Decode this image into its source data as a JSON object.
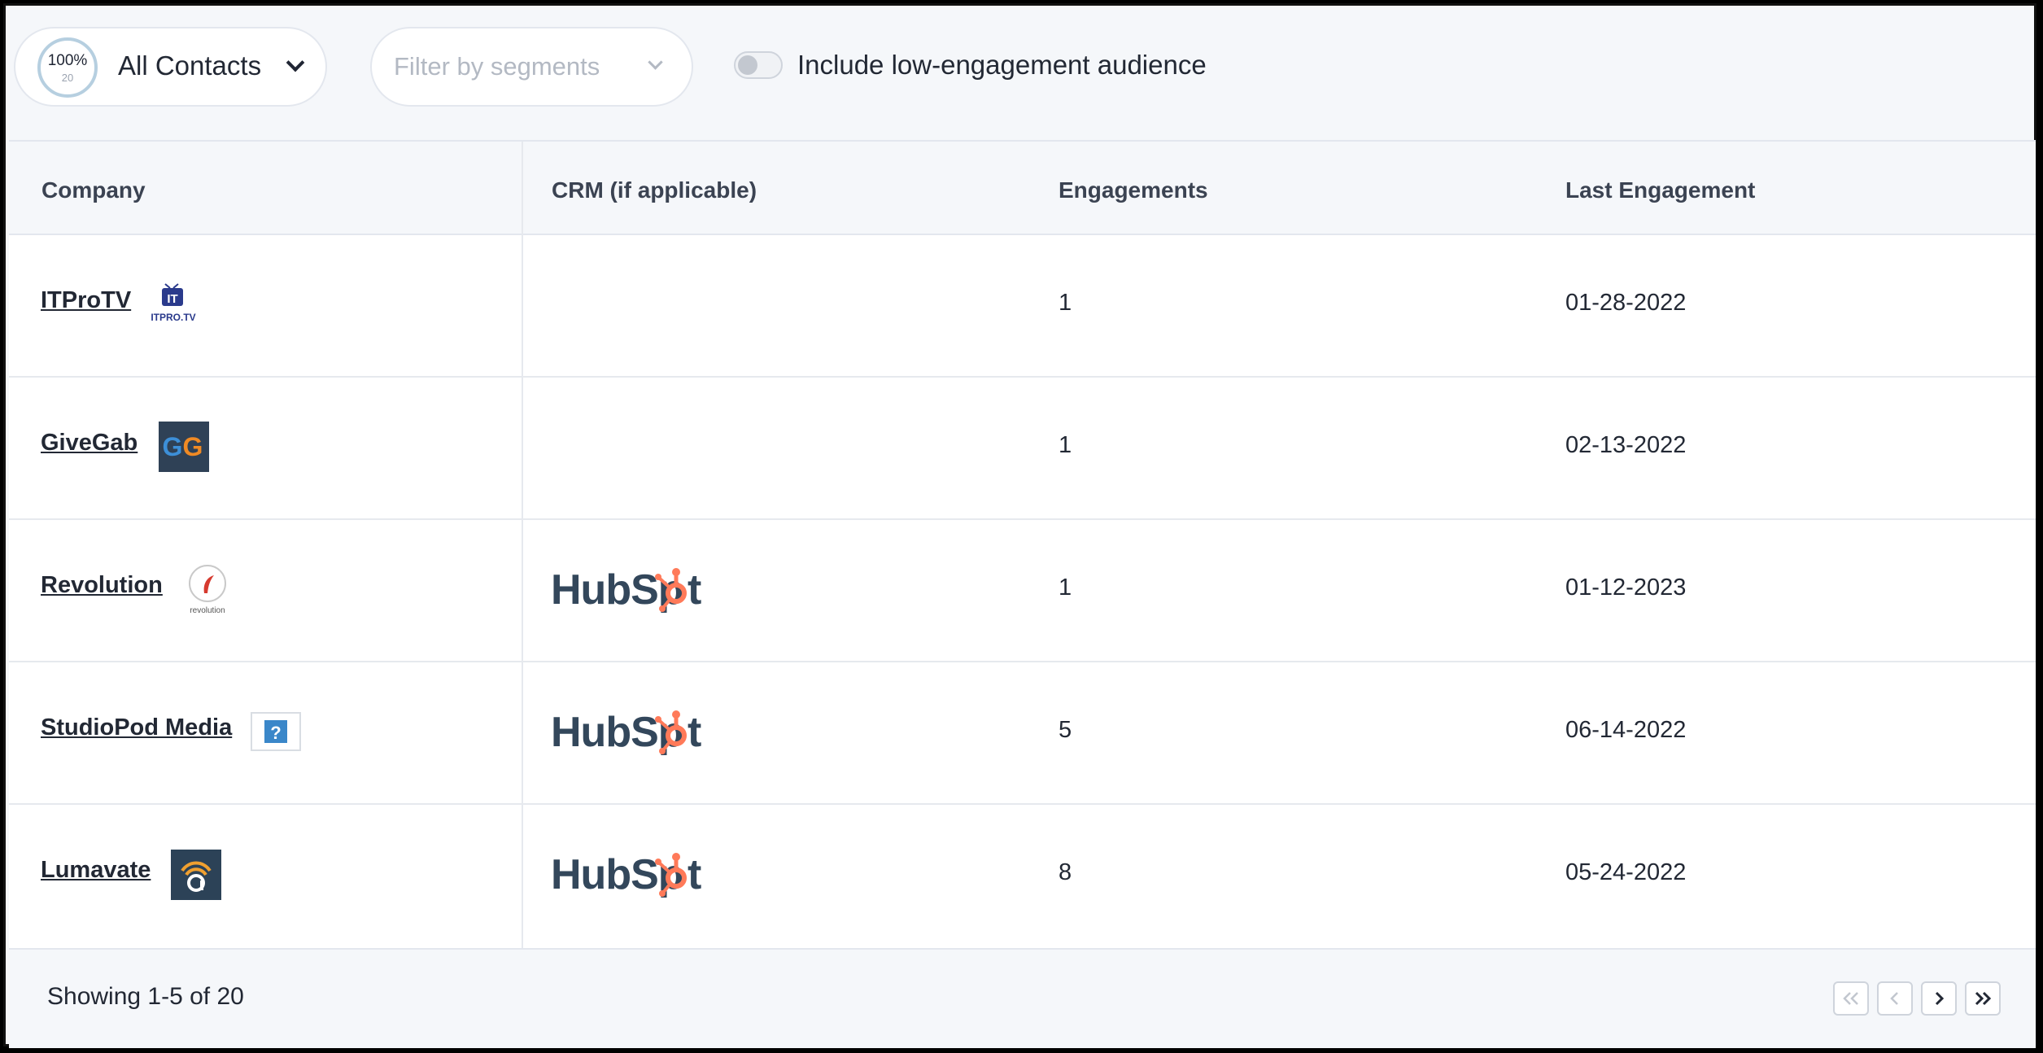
{
  "toolbar": {
    "contacts_percent": "100%",
    "contacts_count": "20",
    "contacts_label": "All Contacts",
    "segments_placeholder": "Filter by segments",
    "toggle_label": "Include low-engagement audience"
  },
  "table": {
    "columns": [
      "Company",
      "CRM (if applicable)",
      "Engagements",
      "Last Engagement"
    ],
    "rows": [
      {
        "company": "ITProTV",
        "logo": "itprotv-logo",
        "crm": "",
        "engagements": "1",
        "last": "01-28-2022"
      },
      {
        "company": "GiveGab",
        "logo": "givegab-logo",
        "crm": "",
        "engagements": "1",
        "last": "02-13-2022"
      },
      {
        "company": "Revolution",
        "logo": "revolution-logo",
        "crm": "HubSpot",
        "engagements": "1",
        "last": "01-12-2023"
      },
      {
        "company": "StudioPod Media",
        "logo": "broken-image-icon",
        "crm": "HubSpot",
        "engagements": "5",
        "last": "06-14-2022"
      },
      {
        "company": "Lumavate",
        "logo": "lumavate-logo",
        "crm": "HubSpot",
        "engagements": "8",
        "last": "05-24-2022"
      }
    ]
  },
  "logos": {
    "itprotv_text": "ITPRO.TV",
    "givegab_text": "GG",
    "revolution_text": "revolution"
  },
  "footer": {
    "showing": "Showing 1-5 of 20"
  },
  "colors": {
    "hubspot_text": "#33475b",
    "hubspot_accent": "#ff7a59",
    "givegab_bg": "#2f4156",
    "lumavate_bg": "#2c4257"
  }
}
